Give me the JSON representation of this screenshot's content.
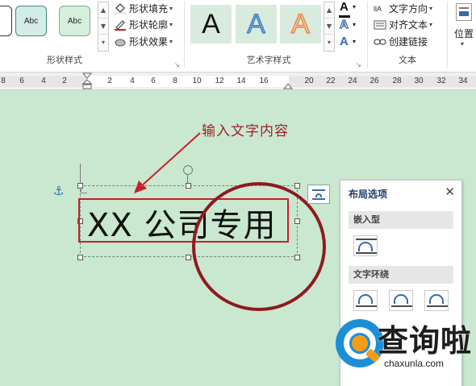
{
  "ribbon": {
    "shape_styles": {
      "group_label": "形状样式",
      "presets": [
        "Abc",
        "Abc"
      ],
      "fill_label": "形状填充",
      "outline_label": "形状轮廓",
      "effects_label": "形状效果"
    },
    "wordart_styles": {
      "group_label": "艺术字样式",
      "presets": [
        "A",
        "A",
        "A"
      ],
      "text_fill_color": "#000000",
      "text_outline_color": "#1f4e8f"
    },
    "text": {
      "group_label": "文本",
      "direction_label": "文字方向",
      "align_label": "对齐文本",
      "link_label": "创建链接"
    },
    "arrange": {
      "position_label": "位置"
    }
  },
  "ruler": {
    "ticks": [
      "8",
      "6",
      "4",
      "2",
      "2",
      "4",
      "6",
      "8",
      "10",
      "12",
      "14",
      "16",
      "20",
      "22",
      "24",
      "26",
      "28",
      "30",
      "32",
      "34"
    ]
  },
  "document": {
    "annotation": "输入文字内容",
    "textbox_text": "XX 公司专用",
    "annotation_color": "#a01e2a",
    "stamp_color": "#8e1a22"
  },
  "layout_panel": {
    "title": "布局选项",
    "section_inline": "嵌入型",
    "section_wrap": "文字环绕"
  },
  "watermark": {
    "brand": "查询啦",
    "domain": "chaxunla.com"
  }
}
